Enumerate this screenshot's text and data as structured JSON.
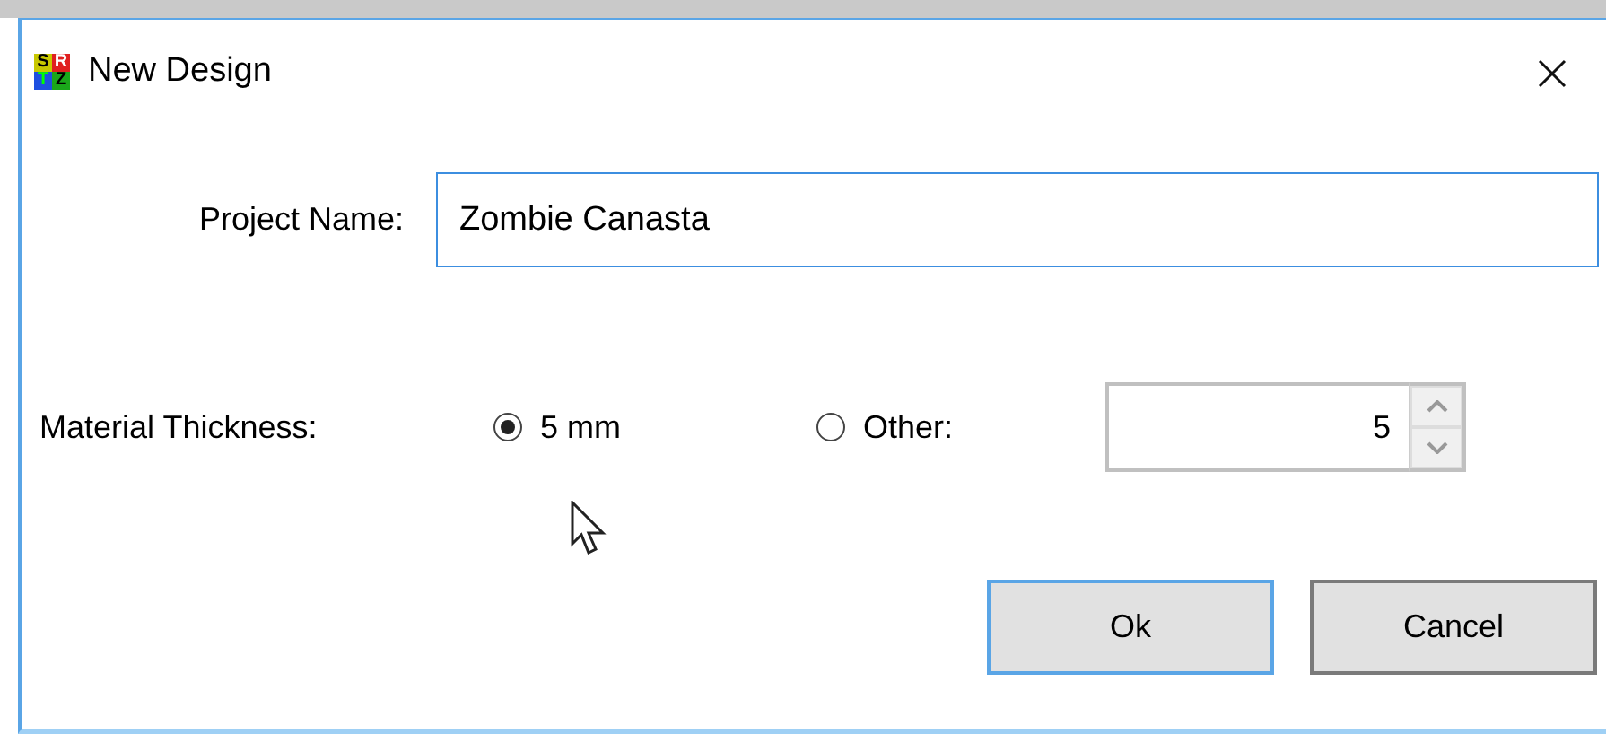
{
  "window": {
    "title": "New Design",
    "logo_letters": [
      "S",
      "R",
      "T",
      "Z"
    ]
  },
  "project_name": {
    "label": "Project Name:",
    "value": "Zombie Canasta",
    "focused": true
  },
  "thickness": {
    "label": "Material Thickness:",
    "options": [
      {
        "label": "5 mm",
        "selected": true
      },
      {
        "label": "Other:",
        "selected": false
      }
    ],
    "other_value": "5"
  },
  "buttons": [
    {
      "label": "Ok",
      "default": true
    },
    {
      "label": "Cancel",
      "default": false
    }
  ]
}
